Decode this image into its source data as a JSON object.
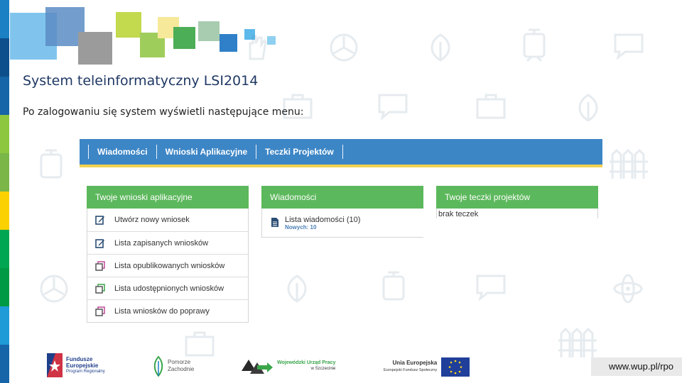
{
  "slide": {
    "title": "System teleinformatyczny LSI2014",
    "subtitle": "Po zalogowaniu się system wyświetli następujące menu:",
    "url": "www.wup.pl/rpo"
  },
  "colors": {
    "title": "#1f3864",
    "navbar": "#3d86c6",
    "navbar_accent": "#f3d24e",
    "panel_header": "#5cb85c",
    "stripe": [
      "#1565a8",
      "#0d4f8c",
      "#1b80c4",
      "#8dc63f",
      "#7ab648",
      "#fbd101",
      "#f4b400",
      "#00a651",
      "#009a44",
      "#1f9bd7"
    ]
  },
  "app": {
    "nav": {
      "items": [
        {
          "label": "Wiadomości"
        },
        {
          "label": "Wnioski Aplikacyjne"
        },
        {
          "label": "Teczki Projektów"
        }
      ]
    },
    "panels": {
      "wnioski": {
        "title": "Twoje wnioski aplikacyjne",
        "items": [
          {
            "label": "Utwórz nowy wniosek",
            "icon": "edit-icon"
          },
          {
            "label": "Lista zapisanych wniosków",
            "icon": "edit-icon"
          },
          {
            "label": "Lista opublikowanych wniosków",
            "icon": "copy-icon"
          },
          {
            "label": "Lista udostępnionych wniosków",
            "icon": "share-icon"
          },
          {
            "label": "Lista wniosków do poprawy",
            "icon": "copy-icon"
          }
        ]
      },
      "wiadomosci": {
        "title": "Wiadomości",
        "item_label": "Lista wiadomości (10)",
        "item_sub": "Nowych: 10",
        "icon": "document-icon"
      },
      "teczki": {
        "title": "Twoje teczki projektów",
        "empty": "brak teczek"
      }
    }
  },
  "footer": {
    "fe_line1": "Fundusze",
    "fe_line2": "Europejskie",
    "fe_line3": "Program Regionalny",
    "pomorze_line1": "Pomorze",
    "pomorze_line2": "Zachodnie",
    "wup_line1": "Wojewódzki Urząd Pracy",
    "wup_line2": "w Szczecinie",
    "ue_line1": "Unia Europejska",
    "ue_line2": "Europejski Fundusz Społeczny"
  }
}
